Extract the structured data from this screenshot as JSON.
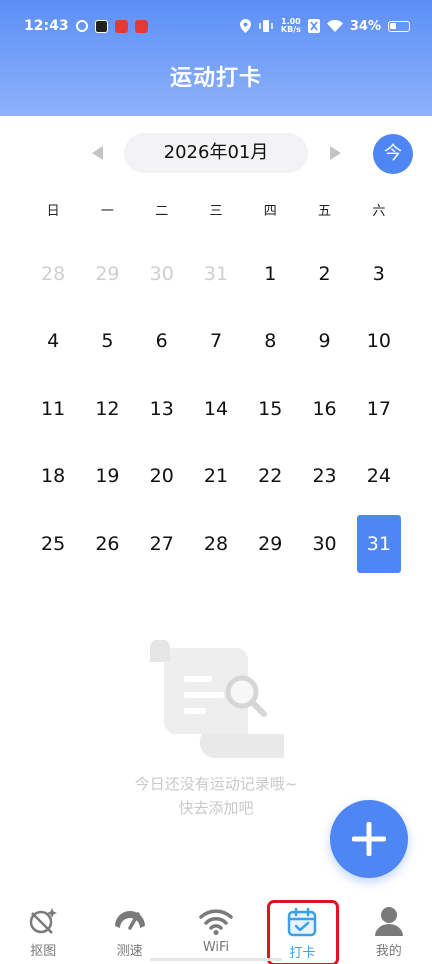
{
  "status_bar": {
    "time": "12:43",
    "net_speed_value": "1.00",
    "net_speed_unit": "KB/s",
    "battery": "34%"
  },
  "header": {
    "title": "运动打卡"
  },
  "calendar": {
    "month_label": "2026年01月",
    "today_button": "今",
    "weekdays": [
      "日",
      "一",
      "二",
      "三",
      "四",
      "五",
      "六"
    ],
    "weeks": [
      [
        "28",
        "29",
        "30",
        "31",
        "1",
        "2",
        "3"
      ],
      [
        "4",
        "5",
        "6",
        "7",
        "8",
        "9",
        "10"
      ],
      [
        "11",
        "12",
        "13",
        "14",
        "15",
        "16",
        "17"
      ],
      [
        "18",
        "19",
        "20",
        "21",
        "22",
        "23",
        "24"
      ],
      [
        "25",
        "26",
        "27",
        "28",
        "29",
        "30",
        "31"
      ]
    ],
    "muted_days_first_row": 4,
    "selected_day": "31"
  },
  "empty_state": {
    "line1": "今日还没有运动记录哦~",
    "line2": "快去添加吧"
  },
  "fab": {
    "icon": "plus-icon"
  },
  "bottom_nav": {
    "items": [
      {
        "label": "抠图",
        "icon": "cutout-icon"
      },
      {
        "label": "测速",
        "icon": "speedometer-icon"
      },
      {
        "label": "WiFi",
        "icon": "wifi-icon"
      },
      {
        "label": "打卡",
        "icon": "calendar-check-icon",
        "active": true
      },
      {
        "label": "我的",
        "icon": "person-icon"
      }
    ]
  },
  "colors": {
    "accent": "#4e87f3",
    "active_nav": "#3aa0e8",
    "highlight_box": "#e0141e"
  }
}
